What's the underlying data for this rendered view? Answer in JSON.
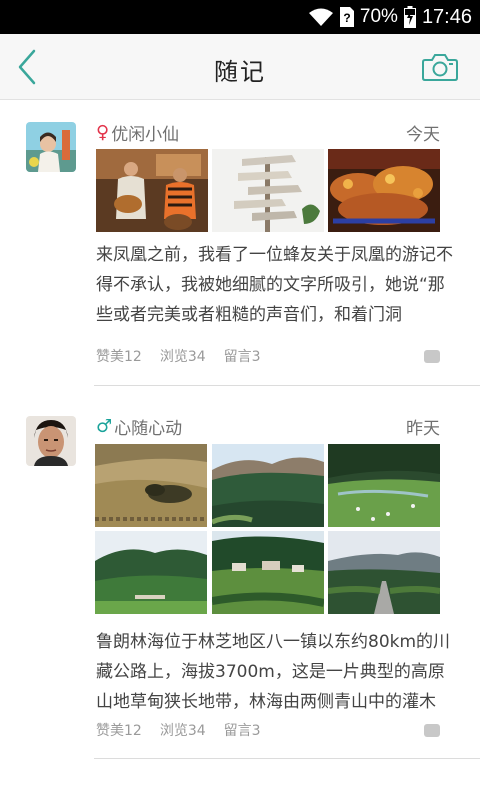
{
  "status": {
    "battery": "70%",
    "time": "17:46"
  },
  "header": {
    "title": "随记"
  },
  "posts": [
    {
      "user": "优闲小仙",
      "gender_symbol": "♀",
      "time": "今天",
      "text": "来凤凰之前，我看了一位蜂友关于凤凰的游记不得不承认，我被她细腻的文字所吸引，她说“那些或者完美或者粗糙的声音们，和着门洞",
      "likes": "赞美12",
      "views": "浏览34",
      "comments": "留言3"
    },
    {
      "user": "心随心动",
      "gender_symbol": "♂",
      "time": "昨天",
      "text": "鲁朗林海位于林芝地区八一镇以东约80km的川藏公路上，海拔3700m，这是一片典型的高原山地草甸狭长地带，林海由两侧青山中的灌木",
      "likes": "赞美12",
      "views": "浏览34",
      "comments": "留言3"
    }
  ]
}
